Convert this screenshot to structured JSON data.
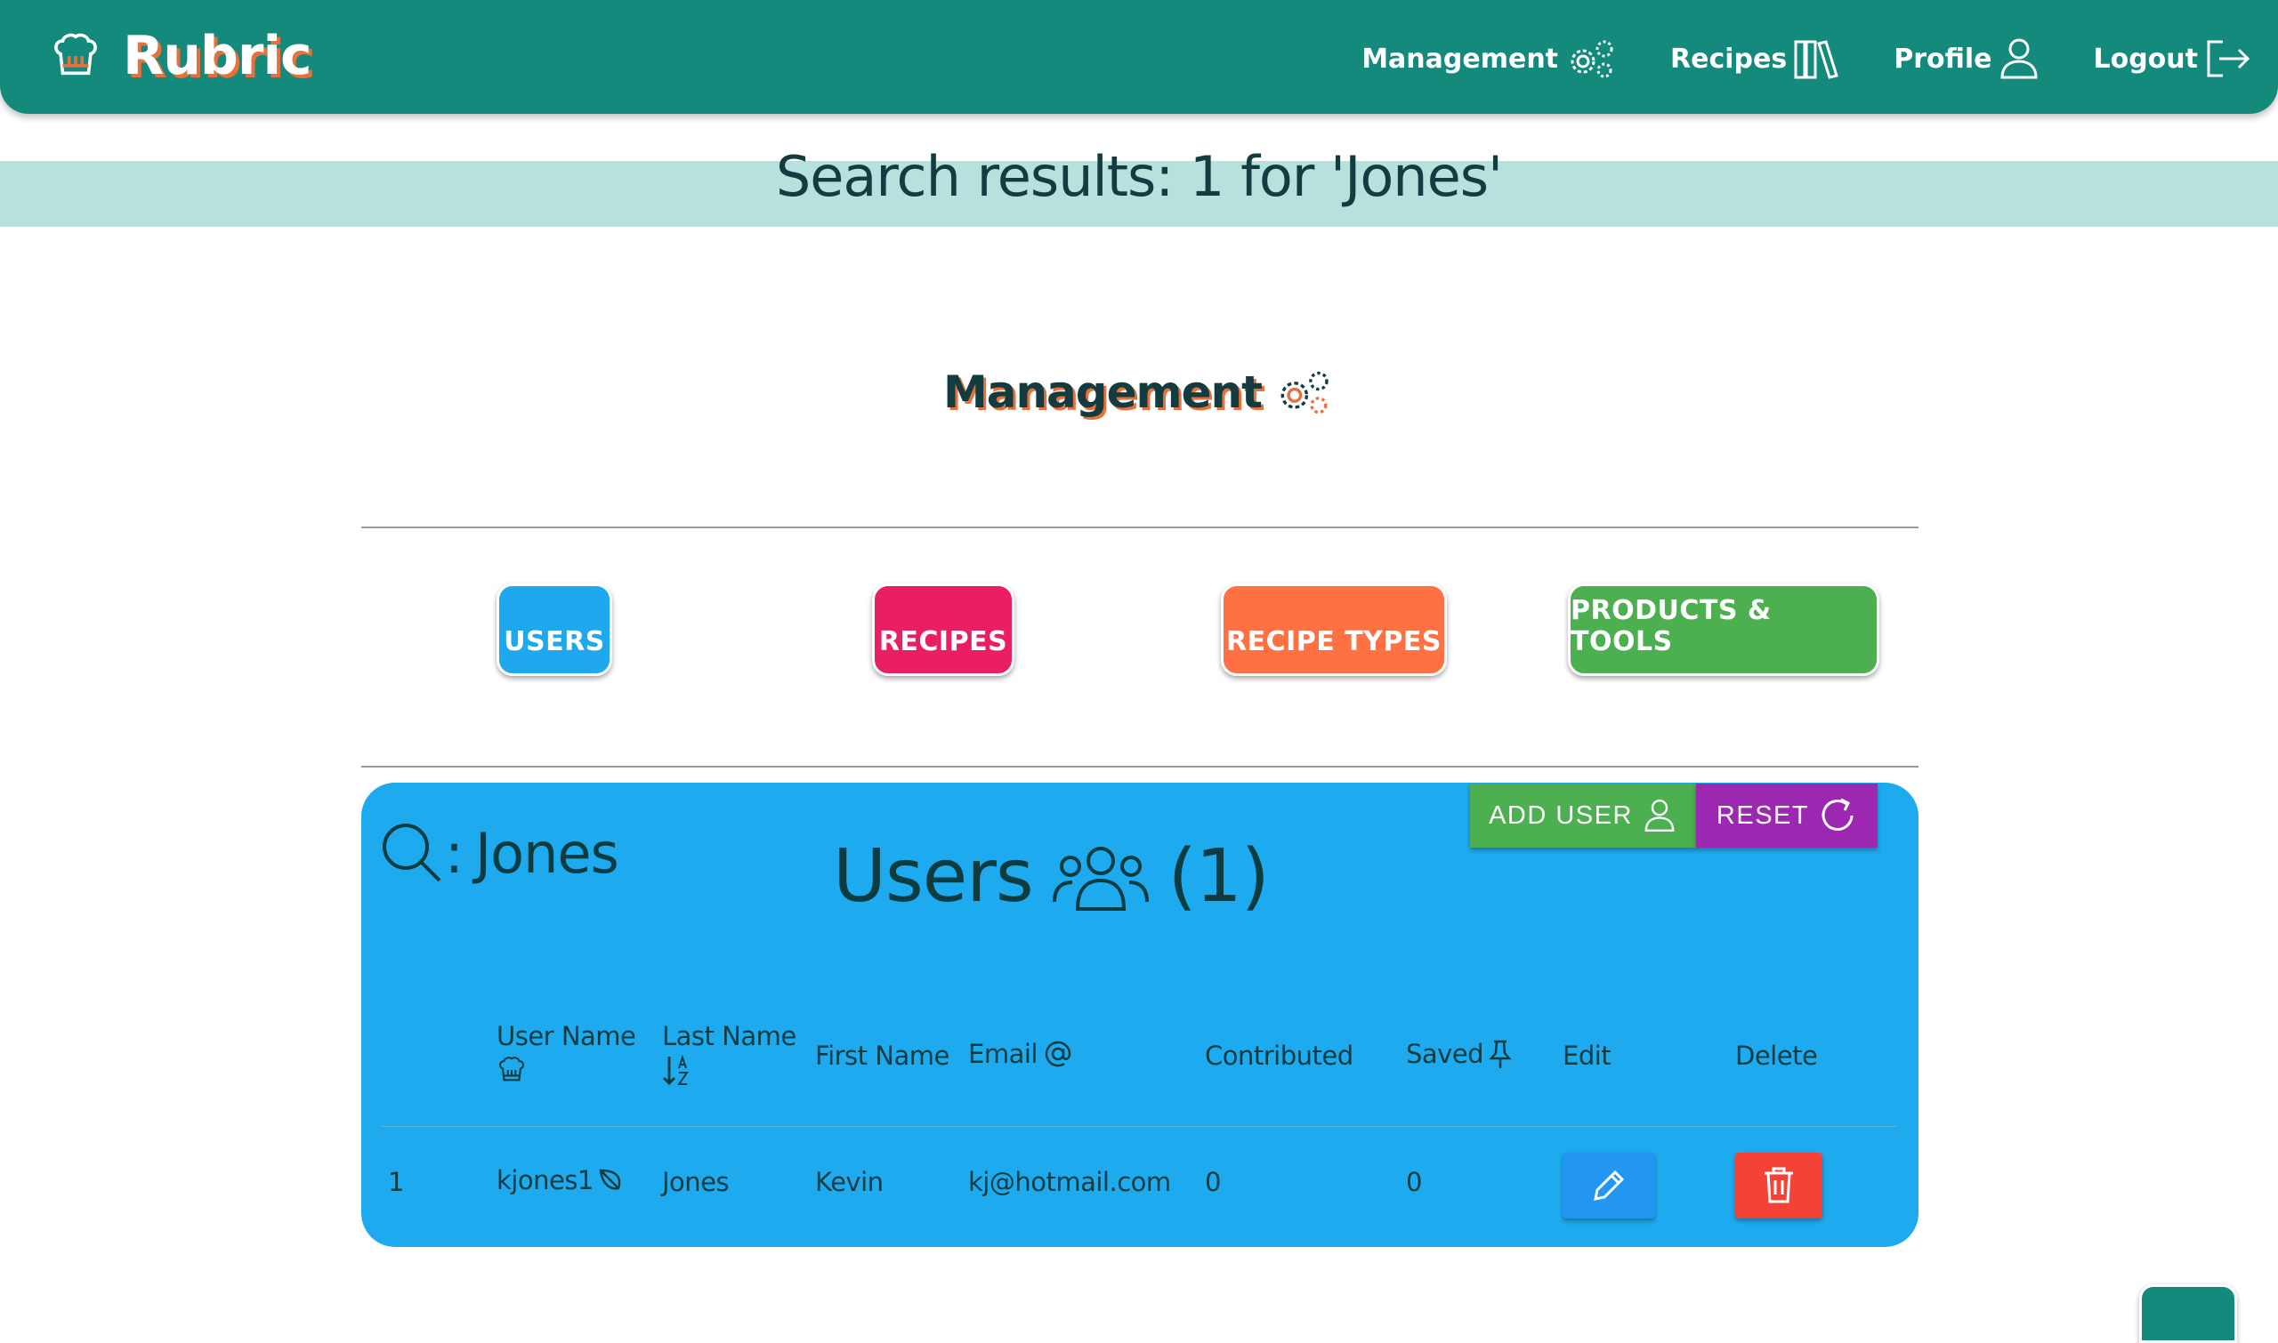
{
  "navbar": {
    "brand": "Rubric",
    "links": [
      {
        "label": "Management",
        "icon": "gears-icon"
      },
      {
        "label": "Recipes",
        "icon": "books-icon"
      },
      {
        "label": "Profile",
        "icon": "person-icon"
      },
      {
        "label": "Logout",
        "icon": "logout-icon"
      }
    ]
  },
  "search_banner": "Search results: 1 for 'Jones'",
  "management": {
    "title": "Management",
    "categories": [
      {
        "label": "USERS",
        "color": "#1ea8ee"
      },
      {
        "label": "RECIPES",
        "color": "#e91e63"
      },
      {
        "label": "RECIPE TYPES",
        "color": "#ff7043"
      },
      {
        "label": "PRODUCTS & TOOLS",
        "color": "#4caf50"
      }
    ]
  },
  "users_panel": {
    "search_prefix": ":",
    "search_term": "Jones",
    "title": "Users",
    "count": "(1)",
    "add_user_label": "ADD USER",
    "reset_label": "RESET",
    "columns": {
      "user_name": "User Name",
      "last_name": "Last Name",
      "first_name": "First Name",
      "email": "Email",
      "contributed": "Contributed",
      "saved": "Saved",
      "edit": "Edit",
      "delete": "Delete"
    },
    "rows": [
      {
        "index": "1",
        "user_name": "kjones1",
        "last_name": "Jones",
        "first_name": "Kevin",
        "email": "kj@hotmail.com",
        "contributed": "0",
        "saved": "0"
      }
    ]
  },
  "colors": {
    "navbar": "#138a7c",
    "banner": "#b6e1dd",
    "panel": "#1eaaef",
    "add_user": "#4caf50",
    "reset": "#9c27b0",
    "edit": "#2196f3",
    "delete": "#f44336"
  }
}
